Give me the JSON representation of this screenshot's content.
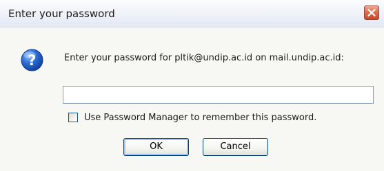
{
  "window": {
    "title": "Enter your password",
    "close_icon": "close-icon"
  },
  "dialog": {
    "icon": "question-icon",
    "prompt": "Enter your password for pltik@undip.ac.id on mail.undip.ac.id:",
    "password_value": "",
    "checkbox": {
      "label": "Use Password Manager to remember this password.",
      "checked": false
    },
    "buttons": {
      "ok_label": "OK",
      "cancel_label": "Cancel"
    }
  },
  "colors": {
    "close_button": "#dc6a4c",
    "question_icon": "#2e6fd6",
    "body_background": "#f7f7f3"
  }
}
